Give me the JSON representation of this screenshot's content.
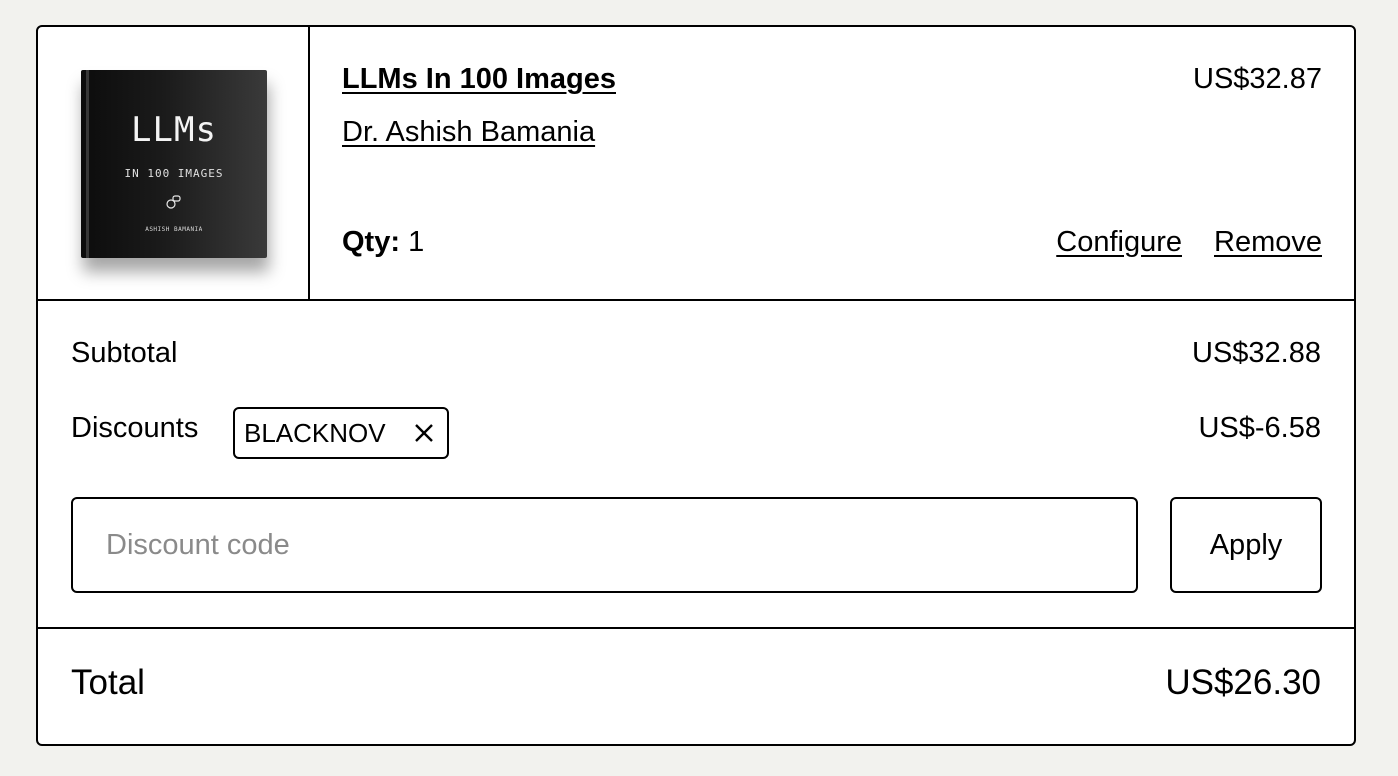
{
  "cart_item": {
    "cover": {
      "title": "LLMs",
      "subtitle": "IN 100 IMAGES",
      "author": "ASHISH BAMANIA"
    },
    "title": "LLMs In 100 Images",
    "author": "Dr. Ashish Bamania",
    "price": "US$32.87",
    "qty_label": "Qty:",
    "qty_value": "1",
    "configure_label": "Configure",
    "remove_label": "Remove"
  },
  "summary": {
    "subtotal_label": "Subtotal",
    "subtotal_value": "US$32.88",
    "discounts_label": "Discounts",
    "discount_code_applied": "BLACKNOV",
    "discount_value": "US$-6.58",
    "discount_input_placeholder": "Discount code",
    "apply_label": "Apply"
  },
  "total": {
    "label": "Total",
    "value": "US$26.30"
  }
}
